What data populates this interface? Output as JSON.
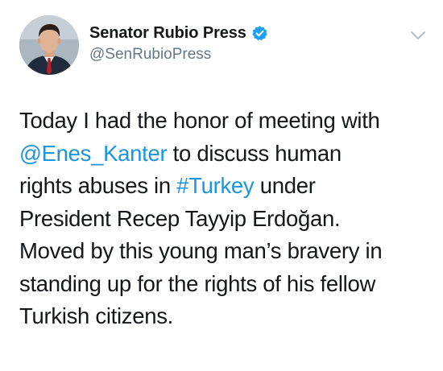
{
  "tweet": {
    "author": {
      "display_name": "Senator Rubio Press",
      "handle": "@SenRubioPress",
      "verified": true,
      "avatar": "profile-photo"
    },
    "menu_icon": "chevron-down-icon",
    "text": {
      "line1": "Today I had the honor of meeting with",
      "mention": "@Enes_Kanter",
      "line2_rest": " to discuss human",
      "line3_start": "rights abuses in ",
      "hashtag": "#Turkey",
      "line3_rest": " under",
      "line4": "President Recep Tayyip Erdoğan.",
      "line5": "Moved by this young man’s bravery in",
      "line6": "standing up for the rights of his fellow",
      "line7": "Turkish citizens."
    }
  },
  "colors": {
    "link": "#1b95e0",
    "verified_badge": "#1da1f2",
    "handle": "#657786",
    "text": "#14171a"
  }
}
